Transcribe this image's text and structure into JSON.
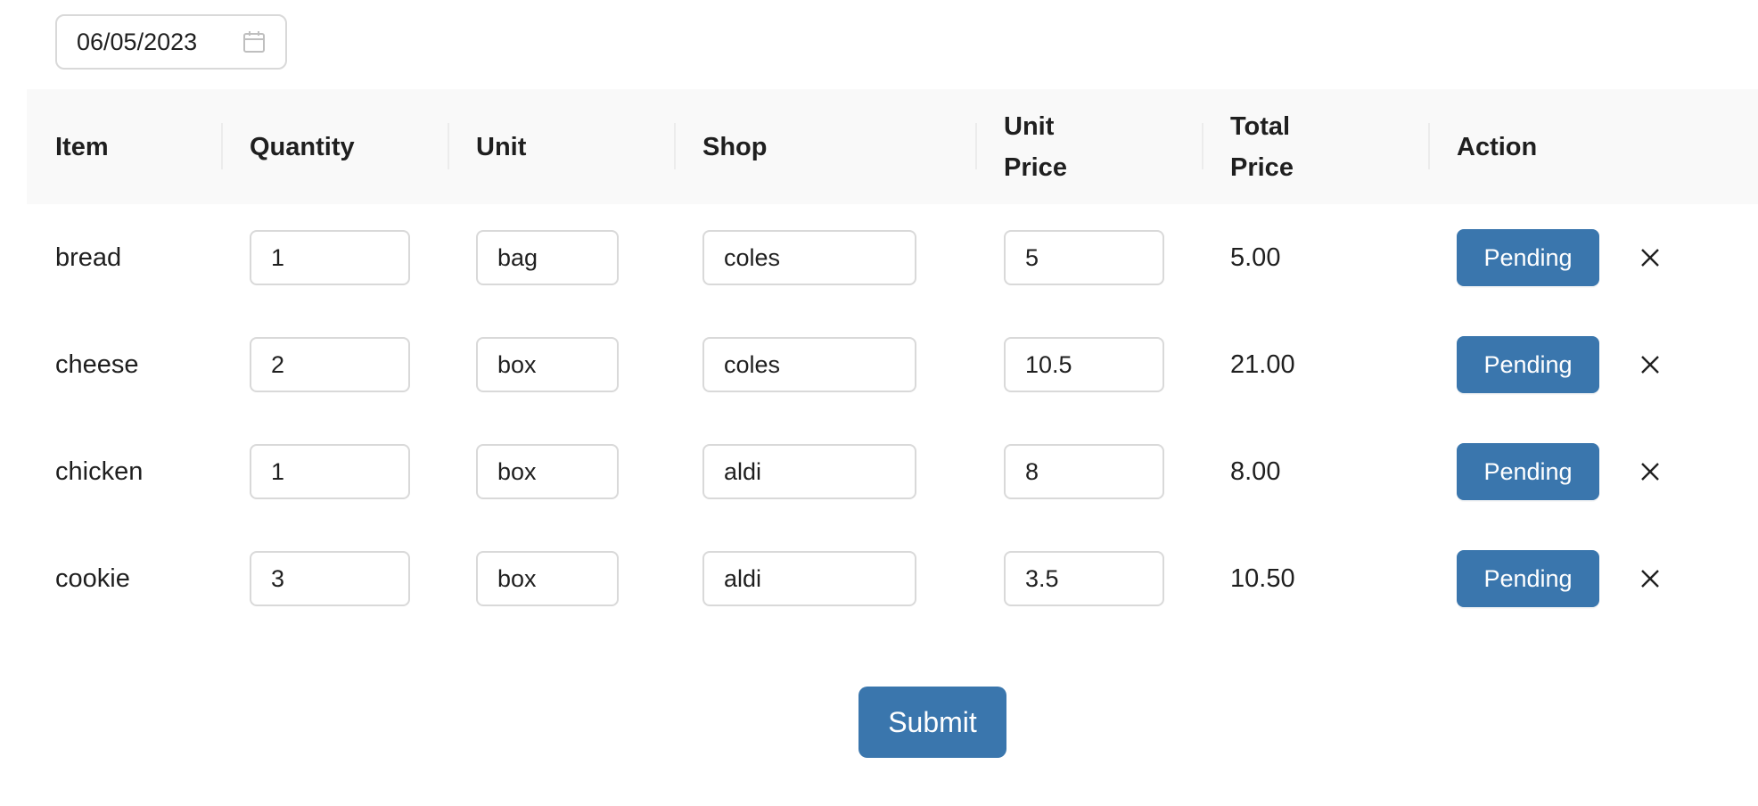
{
  "date_picker": {
    "value": "06/05/2023",
    "icon": "calendar-icon"
  },
  "table": {
    "columns": [
      {
        "key": "item",
        "label": "Item"
      },
      {
        "key": "quantity",
        "label": "Quantity"
      },
      {
        "key": "unit",
        "label": "Unit"
      },
      {
        "key": "shop",
        "label": "Shop"
      },
      {
        "key": "unit_price",
        "label": "Unit Price"
      },
      {
        "key": "total_price",
        "label": "Total Price"
      },
      {
        "key": "action",
        "label": "Action"
      }
    ],
    "rows": [
      {
        "item": "bread",
        "quantity": "1",
        "unit": "bag",
        "shop": "coles",
        "unit_price": "5",
        "total_price": "5.00",
        "action_label": "Pending",
        "delete_icon": "close-icon"
      },
      {
        "item": "cheese",
        "quantity": "2",
        "unit": "box",
        "shop": "coles",
        "unit_price": "10.5",
        "total_price": "21.00",
        "action_label": "Pending",
        "delete_icon": "close-icon"
      },
      {
        "item": "chicken",
        "quantity": "1",
        "unit": "box",
        "shop": "aldi",
        "unit_price": "8",
        "total_price": "8.00",
        "action_label": "Pending",
        "delete_icon": "close-icon"
      },
      {
        "item": "cookie",
        "quantity": "3",
        "unit": "box",
        "shop": "aldi",
        "unit_price": "3.5",
        "total_price": "10.50",
        "action_label": "Pending",
        "delete_icon": "close-icon"
      }
    ]
  },
  "submit": {
    "label": "Submit"
  },
  "colors": {
    "accent": "#3a76ad",
    "header_bg": "#f9f9f9",
    "border": "#d9d9d9"
  }
}
